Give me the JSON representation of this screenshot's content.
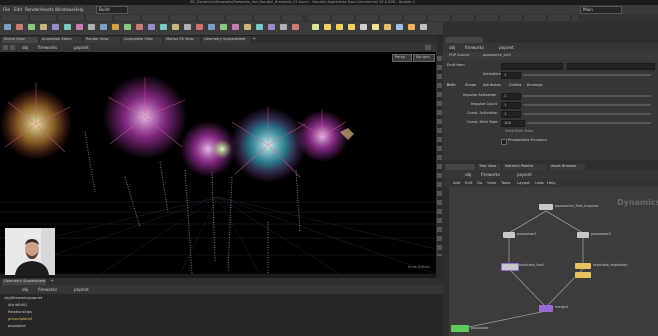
{
  "titlebar": {
    "title": "3D_Dynamics/fireworks/fireworks_rbd_Houdini_fireworks_01.hipnc - Houdini Apprentice Non-Commercial 19.0.498 - Update 1"
  },
  "menu": [
    "File",
    "Edit",
    "Render",
    "Assets",
    "Windows",
    "Help"
  ],
  "build": "Build",
  "main_label": "Main",
  "panes": {
    "scene_view_tab": "Scene View",
    "animation_editor_tab": "Animation Editor",
    "render_view_tab": "Render View",
    "composite_view_tab": "Composite View",
    "motion_fx_tab": "Motion FX View",
    "geometry_spreadsheet_tab": "Geometry Spreadsheet"
  },
  "path": {
    "obj": "obj",
    "node1": "fireworks",
    "node2": "popnet"
  },
  "viewport": {
    "persp": "Persp",
    "cam": "No cam",
    "status": "Indie Edition"
  },
  "params": {
    "node_type": "POP Source",
    "node_name": "popsource_trail",
    "tab": "Source",
    "group_label": "Emit from",
    "activation_label": "Activation",
    "activation_value": "1",
    "subtabs": [
      "Birth",
      "Shape",
      "Attributes",
      "Guides",
      "Bindings"
    ],
    "impulse_activation_label": "Impulse Activation",
    "impulse_activation_value": "1",
    "impulse_count_label": "Impulse Count",
    "impulse_count_value": "1",
    "const_activation_label": "Const. Activation",
    "const_activation_value": "1",
    "const_birth_rate_label": "Const. Birth Rate",
    "const_birth_rate_value": "100",
    "checkbox_label": "Probabilistic Emission",
    "seed_label": "Seed Birth Rate"
  },
  "network": {
    "tabs": [
      "Tree View",
      "Material Palette",
      "Asset Browser"
    ],
    "menu": [
      "Add",
      "Edit",
      "Go",
      "View",
      "Tools",
      "Layout",
      "Labs",
      "Help"
    ],
    "watermark": "Dynamics",
    "nodes": [
      "popsource_first_impulse",
      "popsolver1",
      "popsolver2",
      "replicate_trail",
      "replicate_explosion",
      "merge1",
      "popsolver"
    ]
  },
  "tree": {
    "root": "/obj/fireworks/popnet",
    "items": [
      "AttribEdit1",
      "Relationships",
      "groundplane1",
      "popobject"
    ]
  },
  "colors": {
    "accent": "#f0c040",
    "node_purple": "#9a6ad0",
    "node_yellow": "#e8c060",
    "node_green": "#5fc95f"
  }
}
